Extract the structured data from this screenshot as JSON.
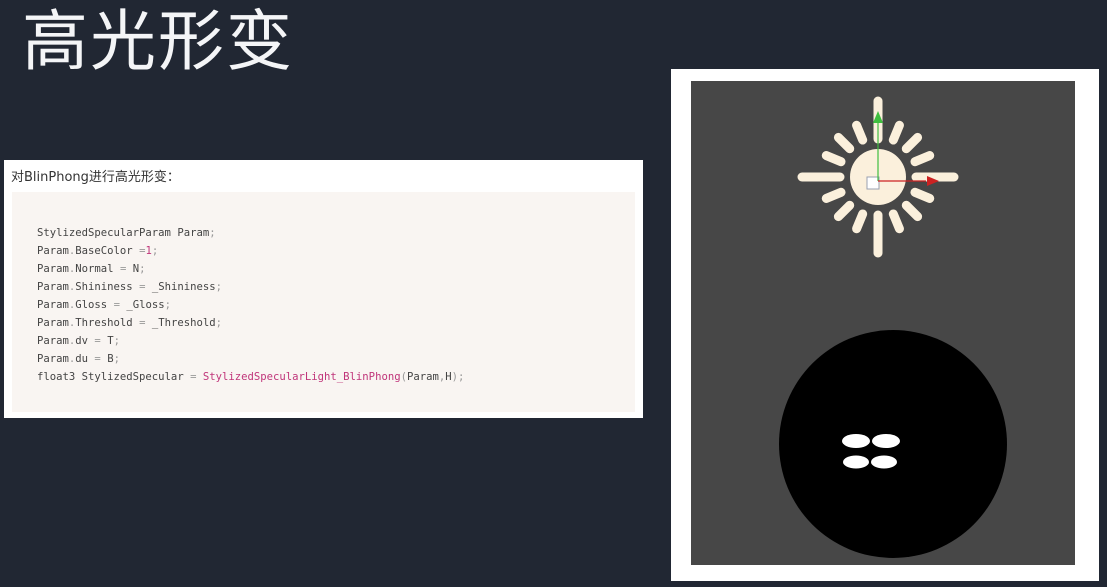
{
  "slide": {
    "title": "高光形变"
  },
  "doc": {
    "heading": "对BlinPhong进行高光形变：",
    "code_lines": [
      [
        {
          "t": "StylizedSpecularParam Param",
          "c": ""
        },
        {
          "t": ";",
          "c": "op"
        }
      ],
      [
        {
          "t": "Param",
          "c": ""
        },
        {
          "t": ".",
          "c": "op"
        },
        {
          "t": "BaseColor ",
          "c": ""
        },
        {
          "t": "=",
          "c": "op"
        },
        {
          "t": "1",
          "c": "num"
        },
        {
          "t": ";",
          "c": "op"
        }
      ],
      [
        {
          "t": "Param",
          "c": ""
        },
        {
          "t": ".",
          "c": "op"
        },
        {
          "t": "Normal ",
          "c": ""
        },
        {
          "t": "=",
          "c": "op"
        },
        {
          "t": " N",
          "c": ""
        },
        {
          "t": ";",
          "c": "op"
        }
      ],
      [
        {
          "t": "Param",
          "c": ""
        },
        {
          "t": ".",
          "c": "op"
        },
        {
          "t": "Shininess ",
          "c": ""
        },
        {
          "t": "=",
          "c": "op"
        },
        {
          "t": " _Shininess",
          "c": ""
        },
        {
          "t": ";",
          "c": "op"
        }
      ],
      [
        {
          "t": "Param",
          "c": ""
        },
        {
          "t": ".",
          "c": "op"
        },
        {
          "t": "Gloss ",
          "c": ""
        },
        {
          "t": "=",
          "c": "op"
        },
        {
          "t": " _Gloss",
          "c": ""
        },
        {
          "t": ";",
          "c": "op"
        }
      ],
      [
        {
          "t": "Param",
          "c": ""
        },
        {
          "t": ".",
          "c": "op"
        },
        {
          "t": "Threshold ",
          "c": ""
        },
        {
          "t": "=",
          "c": "op"
        },
        {
          "t": " _Threshold",
          "c": ""
        },
        {
          "t": ";",
          "c": "op"
        }
      ],
      [
        {
          "t": "Param",
          "c": ""
        },
        {
          "t": ".",
          "c": "op"
        },
        {
          "t": "dv ",
          "c": ""
        },
        {
          "t": "=",
          "c": "op"
        },
        {
          "t": " T",
          "c": ""
        },
        {
          "t": ";",
          "c": "op"
        }
      ],
      [
        {
          "t": "Param",
          "c": ""
        },
        {
          "t": ".",
          "c": "op"
        },
        {
          "t": "du ",
          "c": ""
        },
        {
          "t": "=",
          "c": "op"
        },
        {
          "t": " B",
          "c": ""
        },
        {
          "t": ";",
          "c": "op"
        }
      ],
      [
        {
          "t": "float3 StylizedSpecular ",
          "c": ""
        },
        {
          "t": "=",
          "c": "op"
        },
        {
          "t": " ",
          "c": ""
        },
        {
          "t": "StylizedSpecularLight_BlinPhong",
          "c": "fn"
        },
        {
          "t": "(",
          "c": "op"
        },
        {
          "t": "Param",
          "c": ""
        },
        {
          "t": ",",
          "c": "op"
        },
        {
          "t": "H",
          "c": ""
        },
        {
          "t": ");",
          "c": "op"
        }
      ]
    ]
  },
  "viewport": {
    "icons": [
      "light-gizmo-icon",
      "move-y-arrow-icon",
      "move-x-arrow-icon",
      "sphere-object",
      "specular-highlight"
    ],
    "colors": {
      "background": "#474747",
      "sun": "#fbf0dc",
      "y_axis": "#3fbf3f",
      "x_axis": "#cc2222",
      "sphere": "#000000",
      "highlight": "#ffffff"
    }
  }
}
